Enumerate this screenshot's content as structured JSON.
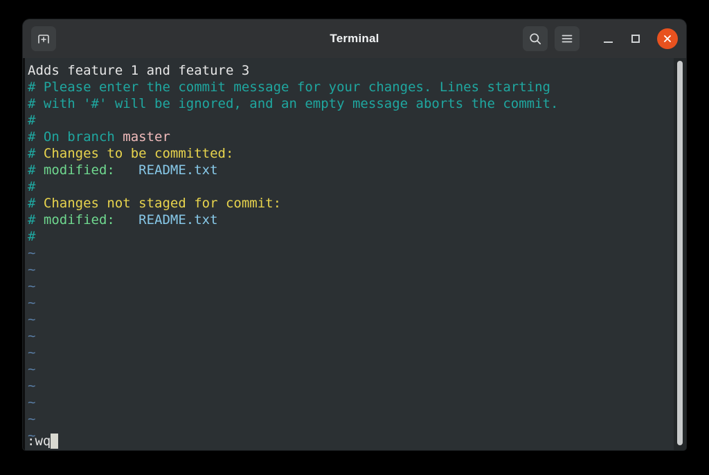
{
  "window": {
    "title": "Terminal",
    "titlebar": {
      "new_tab_label": "new-tab",
      "search_label": "search",
      "menu_label": "main-menu",
      "minimize_label": "minimize",
      "maximize_label": "maximize",
      "close_label": "close"
    },
    "colors": {
      "titlebar_bg": "#303234",
      "terminal_bg": "#2b3033",
      "close_button": "#e8521f",
      "comment": "#1fa7a0",
      "yellow": "#e8d44d",
      "green": "#6fd88f",
      "blue": "#87c8e8",
      "pink": "#f2bcbc",
      "tilde": "#5a7fa8",
      "plain": "#e6e6e6",
      "scrollbar_thumb": "#c9cbcc"
    }
  },
  "terminal": {
    "lines": [
      {
        "segments": [
          {
            "text": "Adds feature 1 and feature 3",
            "color": "c-plain"
          }
        ]
      },
      {
        "segments": [
          {
            "text": "# Please enter the commit message for your changes. Lines starting",
            "color": "c-cmt"
          }
        ]
      },
      {
        "segments": [
          {
            "text": "# with '#' will be ignored, and an empty message aborts the commit.",
            "color": "c-cmt"
          }
        ]
      },
      {
        "segments": [
          {
            "text": "#",
            "color": "c-cmt"
          }
        ]
      },
      {
        "segments": [
          {
            "text": "# ",
            "color": "c-cmt"
          },
          {
            "text": "On branch ",
            "color": "c-cmt"
          },
          {
            "text": "master",
            "color": "c-pink"
          }
        ]
      },
      {
        "segments": [
          {
            "text": "# ",
            "color": "c-cmt"
          },
          {
            "text": "Changes to be committed:",
            "color": "c-yellow"
          }
        ]
      },
      {
        "segments": [
          {
            "text": "# ",
            "color": "c-cmt"
          },
          {
            "text": "modified:   ",
            "color": "c-green"
          },
          {
            "text": "README.txt",
            "color": "c-blue"
          }
        ]
      },
      {
        "segments": [
          {
            "text": "#",
            "color": "c-cmt"
          }
        ]
      },
      {
        "segments": [
          {
            "text": "# ",
            "color": "c-cmt"
          },
          {
            "text": "Changes not staged for commit:",
            "color": "c-yellow"
          }
        ]
      },
      {
        "segments": [
          {
            "text": "# ",
            "color": "c-cmt"
          },
          {
            "text": "modified:   ",
            "color": "c-green"
          },
          {
            "text": "README.txt",
            "color": "c-blue"
          }
        ]
      },
      {
        "segments": [
          {
            "text": "#",
            "color": "c-cmt"
          }
        ]
      },
      {
        "segments": [
          {
            "text": "~",
            "color": "c-tilde"
          }
        ]
      },
      {
        "segments": [
          {
            "text": "~",
            "color": "c-tilde"
          }
        ]
      },
      {
        "segments": [
          {
            "text": "~",
            "color": "c-tilde"
          }
        ]
      },
      {
        "segments": [
          {
            "text": "~",
            "color": "c-tilde"
          }
        ]
      },
      {
        "segments": [
          {
            "text": "~",
            "color": "c-tilde"
          }
        ]
      },
      {
        "segments": [
          {
            "text": "~",
            "color": "c-tilde"
          }
        ]
      },
      {
        "segments": [
          {
            "text": "~",
            "color": "c-tilde"
          }
        ]
      },
      {
        "segments": [
          {
            "text": "~",
            "color": "c-tilde"
          }
        ]
      },
      {
        "segments": [
          {
            "text": "~",
            "color": "c-tilde"
          }
        ]
      },
      {
        "segments": [
          {
            "text": "~",
            "color": "c-tilde"
          }
        ]
      },
      {
        "segments": [
          {
            "text": "~",
            "color": "c-tilde"
          }
        ]
      },
      {
        "segments": [
          {
            "text": "~",
            "color": "c-tilde"
          }
        ]
      }
    ],
    "command_line": ":wq",
    "cursor": "block"
  }
}
